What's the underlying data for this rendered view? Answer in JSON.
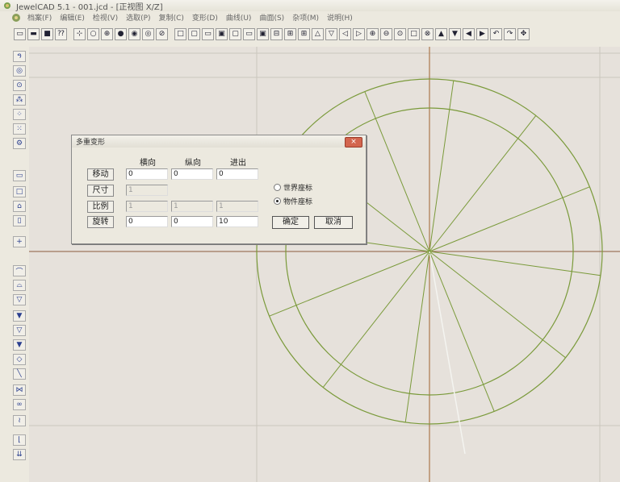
{
  "app": {
    "title": "JewelCAD 5.1 - 001.jcd - [正视图 X/Z]"
  },
  "menu": [
    "档案(F)",
    "编辑(E)",
    "检视(V)",
    "选取(P)",
    "复制(C)",
    "变形(D)",
    "曲线(U)",
    "曲面(S)",
    "杂项(M)",
    "说明(H)"
  ],
  "dialog": {
    "title": "多重变形",
    "close_label": "×",
    "columns": [
      "横向",
      "纵向",
      "进出"
    ],
    "rows": [
      {
        "label": "移动",
        "values": [
          "0",
          "0",
          "0"
        ],
        "enabled": [
          true,
          true,
          true
        ]
      },
      {
        "label": "尺寸",
        "values": [
          "1"
        ],
        "enabled": [
          false
        ]
      },
      {
        "label": "比例",
        "values": [
          "1",
          "1",
          "1"
        ],
        "enabled": [
          false,
          false,
          false
        ]
      },
      {
        "label": "旋转",
        "values": [
          "0",
          "0",
          "10"
        ],
        "enabled": [
          true,
          true,
          true
        ]
      }
    ],
    "coords": {
      "world": "世界座标",
      "object": "物件座标",
      "selected": "object"
    },
    "ok": "确定",
    "cancel": "取消"
  },
  "colors": {
    "curve": "#7a9a3a",
    "axis_h": "#8c5a3c",
    "axis_v": "#a0622f",
    "grid": "#c9c4bc",
    "canvas_bg": "#e6e1db"
  }
}
